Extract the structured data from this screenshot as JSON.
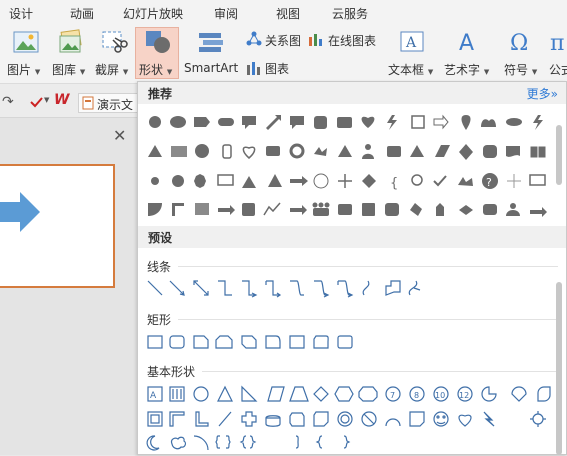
{
  "menu": {
    "tabs": [
      "设计",
      "动画",
      "幻灯片放映",
      "审阅",
      "视图",
      "云服务"
    ]
  },
  "ribbon": {
    "picture": "图片",
    "gallery": "图库",
    "screenshot": "截屏",
    "shapes": "形状",
    "smartart": "SmartArt",
    "relationship": "关系图",
    "online_chart": "在线图表",
    "chart": "图表",
    "textbox": "文本框",
    "wordart": "艺术字",
    "symbol": "符号",
    "formula": "公式"
  },
  "quickbar": {
    "doc_tab": "演示文"
  },
  "panel": {
    "recommended": "推荐",
    "more": "更多",
    "preset": "预设",
    "lines": "线条",
    "rectangles": "矩形",
    "basic_shapes": "基本形状"
  },
  "colors": {
    "accent_orange": "#d57b3d",
    "shape_gray": "#6b6b6b",
    "outline_blue": "#3f6fa8",
    "link_blue": "#2f7ad5"
  }
}
